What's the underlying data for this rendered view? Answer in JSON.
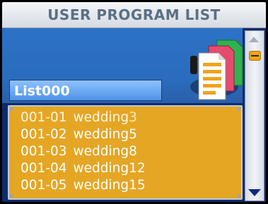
{
  "header": {
    "title": "USER PROGRAM LIST"
  },
  "list": {
    "name": "List000",
    "items": [
      {
        "code": "001-01",
        "name": "wedding",
        "num": "3"
      },
      {
        "code": "001-02",
        "name": "wedding",
        "num": "5"
      },
      {
        "code": "001-03",
        "name": "wedding",
        "num": "8"
      },
      {
        "code": "001-04",
        "name": "wedding",
        "num": "12"
      },
      {
        "code": "001-05",
        "name": "wedding",
        "num": "15"
      }
    ],
    "selected_index": 0
  },
  "icons": {
    "file_icon": "program-files-icon",
    "scroll_up": "scroll-up-icon",
    "scroll_down": "scroll-down-icon"
  },
  "colors": {
    "list_background": "#e5a624",
    "panel_background": "#2a6cbd",
    "title_text": "#5a6f86",
    "scroll_thumb": "#e8a51c"
  }
}
